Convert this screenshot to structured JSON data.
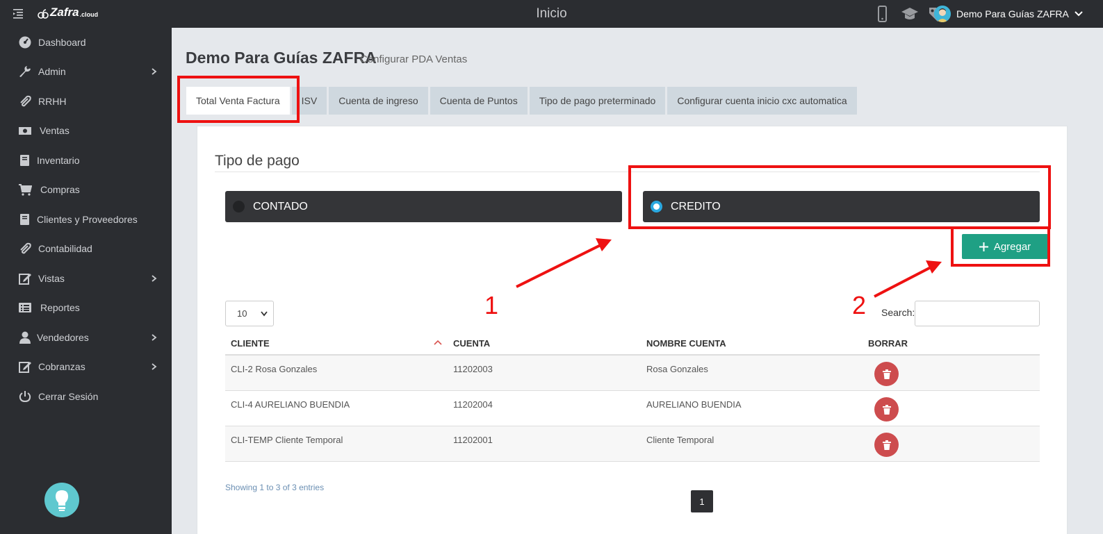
{
  "topbar": {
    "logo_text": "Zafra",
    "logo_sub": ".cloud",
    "title": "Inicio",
    "user_name": "Demo Para Guías ZAFRA"
  },
  "sidebar": {
    "items": [
      {
        "label": "Dashboard",
        "icon": "dashboard-icon"
      },
      {
        "label": "Admin",
        "icon": "wrench-icon",
        "has_children": true
      },
      {
        "label": "RRHH",
        "icon": "paperclip-icon"
      },
      {
        "label": "Ventas",
        "icon": "money-icon"
      },
      {
        "label": "Inventario",
        "icon": "book-icon"
      },
      {
        "label": "Compras",
        "icon": "cart-icon"
      },
      {
        "label": "Clientes y Proveedores",
        "icon": "book-icon"
      },
      {
        "label": "Contabilidad",
        "icon": "paperclip-icon"
      },
      {
        "label": "Vistas",
        "icon": "edit-icon",
        "has_children": true
      },
      {
        "label": "Reportes",
        "icon": "list-icon"
      },
      {
        "label": "Vendedores",
        "icon": "user-icon",
        "has_children": true
      },
      {
        "label": "Cobranzas",
        "icon": "edit-icon",
        "has_children": true
      },
      {
        "label": "Cerrar Sesión",
        "icon": "power-icon"
      }
    ]
  },
  "page": {
    "title": "Demo Para Guías ZAFRA",
    "subtitle": "Configurar PDA Ventas"
  },
  "tabs": [
    {
      "label": "Total Venta Factura",
      "active": true
    },
    {
      "label": "ISV",
      "active": false
    },
    {
      "label": "Cuenta de ingreso",
      "active": false
    },
    {
      "label": "Cuenta de Puntos",
      "active": false
    },
    {
      "label": "Tipo de pago preterminado",
      "active": false
    },
    {
      "label": "Configurar cuenta inicio cxc automatica",
      "active": false
    }
  ],
  "payment": {
    "section_title": "Tipo de pago",
    "options": [
      {
        "label": "CONTADO",
        "selected": false
      },
      {
        "label": "CREDITO",
        "selected": true
      }
    ],
    "add_label": "Agregar"
  },
  "table": {
    "length_value": "10",
    "search_label": "Search:",
    "search_value": "",
    "columns": [
      "CLIENTE",
      "CUENTA",
      "NOMBRE CUENTA",
      "BORRAR"
    ],
    "rows": [
      {
        "cliente": "CLI-2 Rosa Gonzales",
        "cuenta": "11202003",
        "nombre": "Rosa Gonzales"
      },
      {
        "cliente": "CLI-4 AURELIANO BUENDIA",
        "cuenta": "11202004",
        "nombre": "AURELIANO BUENDIA"
      },
      {
        "cliente": "CLI-TEMP Cliente Temporal",
        "cuenta": "11202001",
        "nombre": "Cliente Temporal"
      }
    ],
    "info": "Showing 1 to 3 of 3 entries",
    "current_page": "1"
  },
  "annotations": {
    "step1": "1",
    "step2": "2",
    "color": "#ee1111"
  },
  "colors": {
    "sidebar_bg": "#2b2d31",
    "accent_green": "#1fa084",
    "delete_red": "#cd4c4e",
    "radio_blue": "#2aa8e0"
  }
}
